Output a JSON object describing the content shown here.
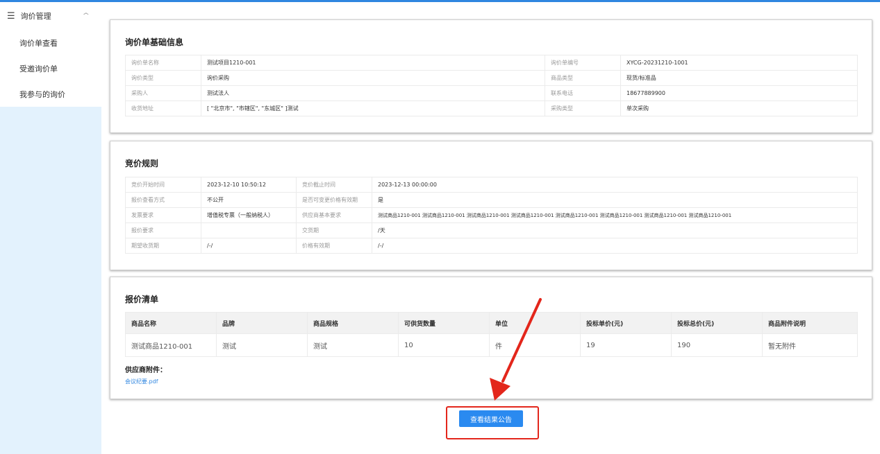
{
  "sidebar": {
    "group_label": "询价管理",
    "items": [
      {
        "label": "询价单查看"
      },
      {
        "label": "受邀询价单"
      },
      {
        "label": "我参与的询价"
      }
    ]
  },
  "basic_info": {
    "title": "询价单基础信息",
    "rows": [
      {
        "k1": "询价单名称",
        "v1": "测试项目1210-001",
        "k2": "询价单编号",
        "v2": "XYCG-20231210-1001"
      },
      {
        "k1": "询价类型",
        "v1": "询价采购",
        "k2": "商品类型",
        "v2": "现货/标准品"
      },
      {
        "k1": "采购人",
        "v1": "测试法人",
        "k2": "联系电话",
        "v2": "18677889900"
      },
      {
        "k1": "收货地址",
        "v1": "[ \"北京市\", \"市辖区\", \"东城区\" ]测试",
        "k2": "采购类型",
        "v2": "单次采购"
      }
    ]
  },
  "rules": {
    "title": "竞价规则",
    "rows": [
      {
        "k1": "竞价开始时间",
        "v1": "2023-12-10 10:50:12",
        "k2": "竞价截止时间",
        "v2": "2023-12-13 00:00:00"
      },
      {
        "k1": "报价查看方式",
        "v1": "不公开",
        "k2": "是否可变更价格有效期",
        "v2": "是"
      },
      {
        "k1": "发票要求",
        "v1": "增值税专票（一般纳税人）",
        "k2": "供应商基本要求",
        "v2": "测试商品1210-001 测试商品1210-001 测试商品1210-001 测试商品1210-001 测试商品1210-001 测试商品1210-001 测试商品1210-001 测试商品1210-001"
      },
      {
        "k1": "报价要求",
        "v1": "",
        "k2": "交货期",
        "v2": "/天"
      },
      {
        "k1": "期望收货期",
        "v1": "/-/",
        "k2": "价格有效期",
        "v2": "/-/"
      }
    ]
  },
  "quote_list": {
    "title": "报价清单",
    "headers": [
      "商品名称",
      "品牌",
      "商品规格",
      "可供货数量",
      "单位",
      "投标单价(元)",
      "投标总价(元)",
      "商品附件说明"
    ],
    "rows": [
      [
        "测试商品1210-001",
        "测试",
        "测试",
        "10",
        "件",
        "19",
        "190",
        "暂无附件"
      ]
    ],
    "attachments_title": "供应商附件：",
    "attachment_file": "会议纪要.pdf"
  },
  "actions": {
    "view_result_label": "查看结果公告"
  },
  "colors": {
    "accent": "#2a8af0",
    "sidebar_bg": "#e3f2fd",
    "annotation_red": "#e3261b"
  }
}
